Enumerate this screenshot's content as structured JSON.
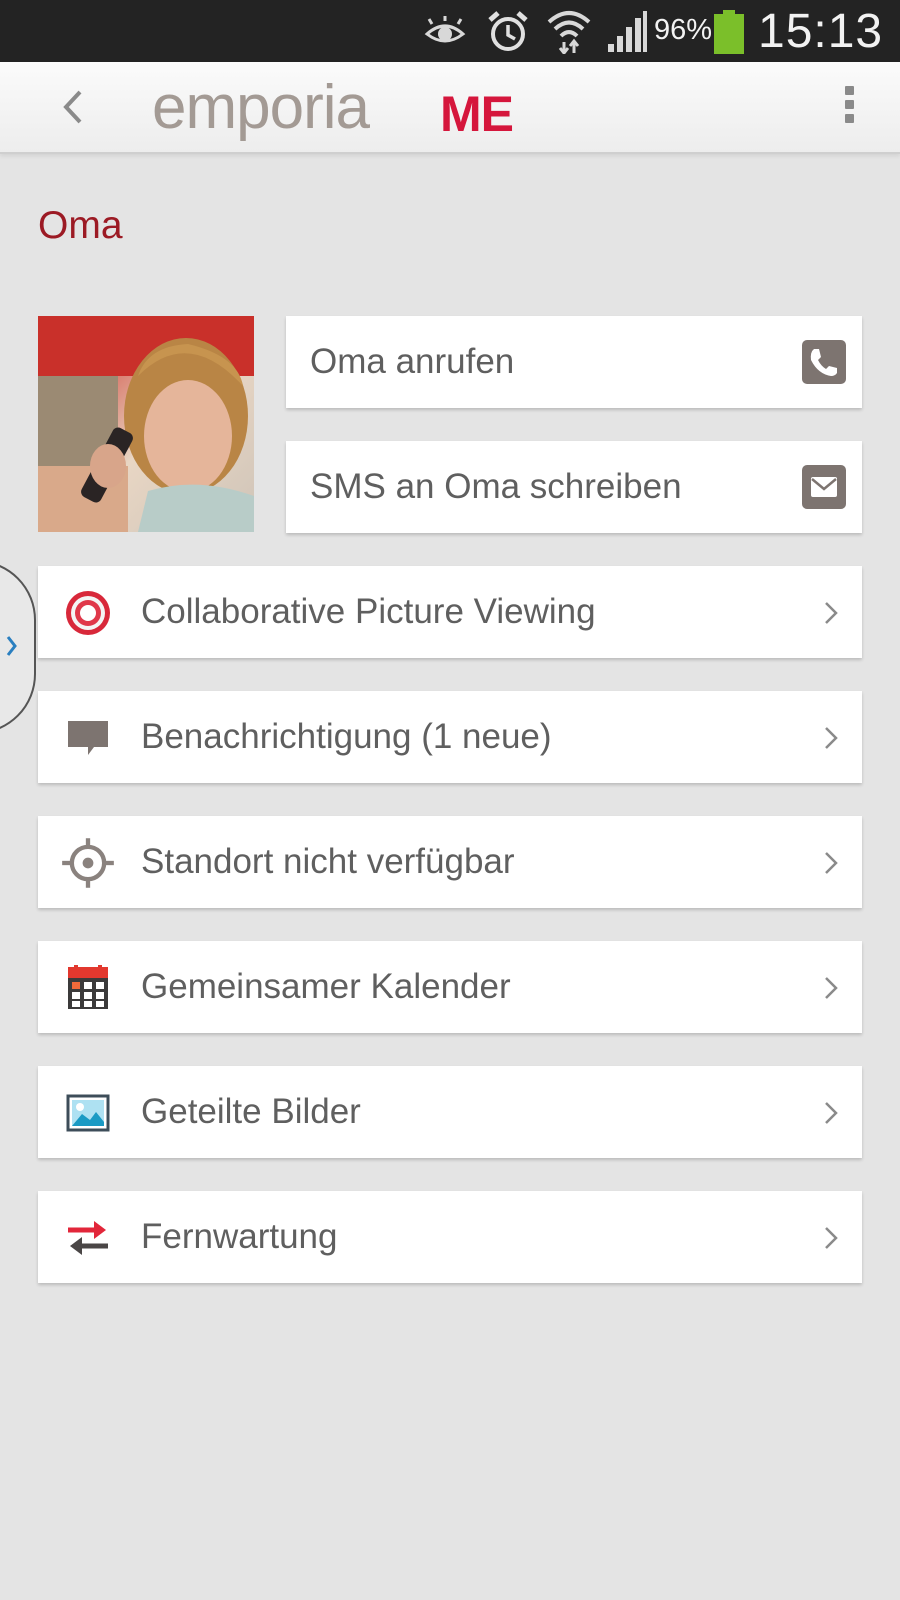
{
  "status_bar": {
    "battery_percent": "96%",
    "time": "15:13",
    "icons": [
      "eye-icon",
      "alarm-icon",
      "wifi-icon",
      "signal-icon",
      "battery-icon"
    ],
    "battery_color": "#7bbf2a"
  },
  "action_bar": {
    "logo_word": "emporia",
    "logo_suffix": "ME",
    "brand_color": "#d5163c"
  },
  "contact": {
    "name": "Oma",
    "call_label": "Oma anrufen",
    "sms_label": "SMS an Oma schreiben"
  },
  "menu": [
    {
      "label": "Collaborative Picture Viewing",
      "icon": "target-ring-icon"
    },
    {
      "label": "Benachrichtigung (1 neue)",
      "icon": "speech-bubble-icon"
    },
    {
      "label": "Standort nicht verfügbar",
      "icon": "crosshair-icon"
    },
    {
      "label": "Gemeinsamer Kalender",
      "icon": "calendar-icon"
    },
    {
      "label": "Geteilte Bilder",
      "icon": "picture-icon"
    },
    {
      "label": "Fernwartung",
      "icon": "transfer-arrows-icon"
    }
  ]
}
